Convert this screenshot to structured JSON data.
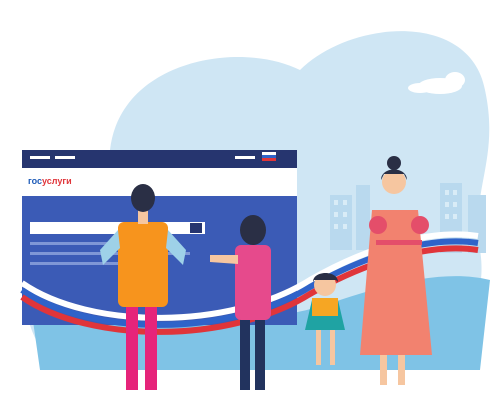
{
  "screen": {
    "logo_part1": "гос",
    "logo_part2": "услуги"
  },
  "colors": {
    "sky": "#cfe6f4",
    "sky_deep": "#a9d2ee",
    "ground": "#7fc3e6",
    "screen_frame": "#26356f",
    "screen_header": "#ffffff",
    "screen_body": "#3b5bb6",
    "flag_white": "#ffffff",
    "flag_blue": "#2f63c9",
    "flag_red": "#e0353a",
    "logo_blue": "#1e5bb8",
    "logo_red": "#e0353a",
    "man_vest": "#f7941d",
    "man_pants": "#e6247a",
    "boy_shirt": "#e64a8c",
    "boy_pants": "#22335e",
    "girl_dress": "#1fa3a3",
    "girl_top": "#f6a623",
    "woman_dress": "#f2826f",
    "woman_sleeve": "#e44e6a",
    "skin": "#f6c6a0",
    "hair": "#2a2f45"
  }
}
